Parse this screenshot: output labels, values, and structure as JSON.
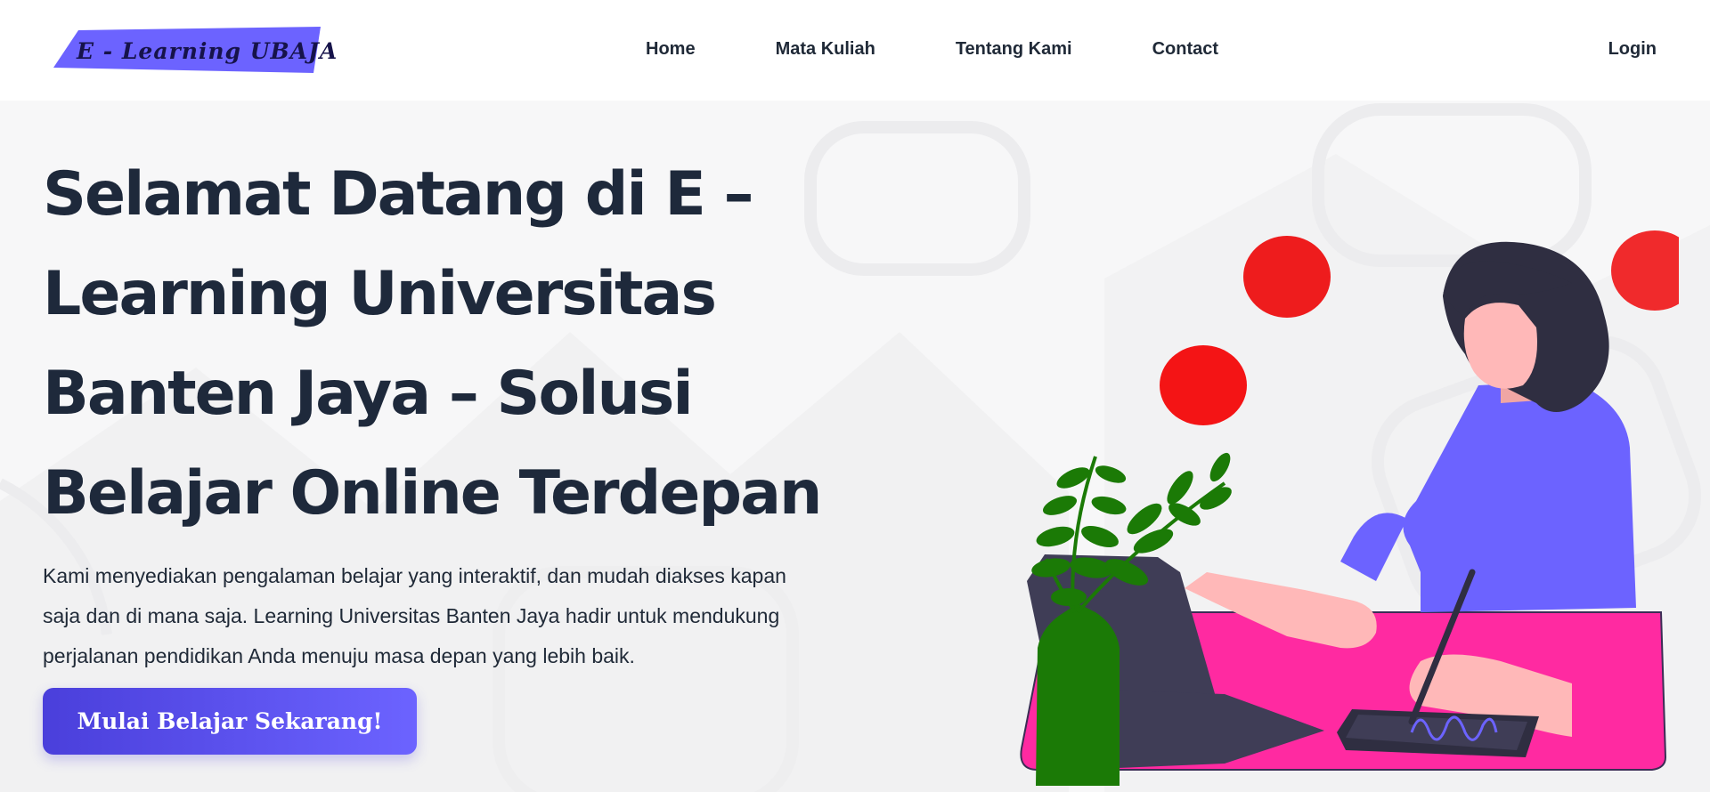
{
  "header": {
    "logo_text": "E - Learning UBAJA",
    "nav": [
      {
        "label": "Home"
      },
      {
        "label": "Mata Kuliah"
      },
      {
        "label": "Tentang Kami"
      },
      {
        "label": "Contact"
      }
    ],
    "login_label": "Login"
  },
  "hero": {
    "title": "Selamat Datang di E – Learning Universitas Banten Jaya – Solusi Belajar Online Terdepan",
    "description": "Kami menyediakan pengalaman belajar yang interaktif, dan mudah diakses kapan saja dan di mana saja. Learning Universitas Banten Jaya hadir untuk mendukung perjalanan pendidikan Anda menuju masa depan yang lebih baik.",
    "cta_label": "Mulai Belajar Sekarang!"
  },
  "colors": {
    "accent": "#6c63ff",
    "button_start": "#4a3fdb",
    "heading": "#1e293b",
    "desk": "#ff2aa1",
    "plant": "#1b7a06",
    "circles": "#f0171a",
    "hair": "#2f2e41"
  },
  "illustration": {
    "icon": "person-working-at-laptop-illustration"
  }
}
